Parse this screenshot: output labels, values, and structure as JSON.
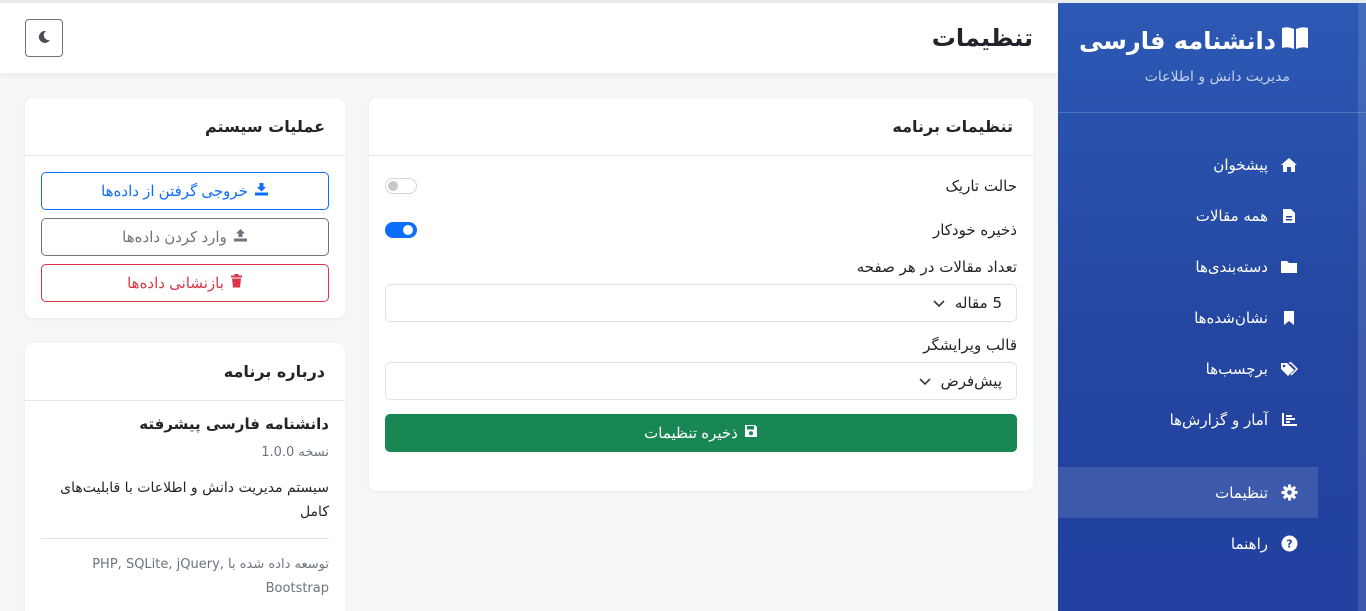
{
  "brand": {
    "title": "دانشنامه فارسی",
    "subtitle": "مدیریت دانش و اطلاعات"
  },
  "nav": [
    {
      "label": "پیشخوان",
      "icon": "home-icon"
    },
    {
      "label": "همه مقالات",
      "icon": "file-icon"
    },
    {
      "label": "دسته‌بندی‌ها",
      "icon": "folder-icon"
    },
    {
      "label": "نشان‌شده‌ها",
      "icon": "bookmark-icon"
    },
    {
      "label": "برچسب‌ها",
      "icon": "tags-icon"
    },
    {
      "label": "آمار و گزارش‌ها",
      "icon": "chart-icon"
    }
  ],
  "nav_bottom": [
    {
      "label": "تنظیمات",
      "icon": "gear-icon",
      "active": true
    },
    {
      "label": "راهنما",
      "icon": "question-icon"
    }
  ],
  "header": {
    "title": "تنظیمات"
  },
  "settings": {
    "title": "تنظیمات برنامه",
    "dark_mode_label": "حالت تاریک",
    "dark_mode": false,
    "autosave_label": "ذخیره خودکار",
    "autosave": true,
    "per_page_label": "تعداد مقالات در هر صفحه",
    "per_page_value": "5 مقاله",
    "editor_label": "قالب ویرایشگر",
    "editor_value": "پیش‌فرض",
    "save_label": "ذخیره تنظیمات"
  },
  "ops": {
    "title": "عملیات سیستم",
    "export_label": "خروجی گرفتن از داده‌ها",
    "import_label": "وارد کردن داده‌ها",
    "reset_label": "بازنشانی داده‌ها"
  },
  "about": {
    "title": "درباره برنامه",
    "name": "دانشنامه فارسی پیشرفته",
    "version": "نسخه 1.0.0",
    "description": "سیستم مدیریت دانش و اطلاعات با قابلیت‌های کامل",
    "tech": "توسعه داده شده با PHP, SQLite, jQuery, Bootstrap"
  },
  "colors": {
    "primary": "#0d6efd",
    "success": "#198754",
    "danger": "#dc3545",
    "sidebar": "#2446a0"
  }
}
